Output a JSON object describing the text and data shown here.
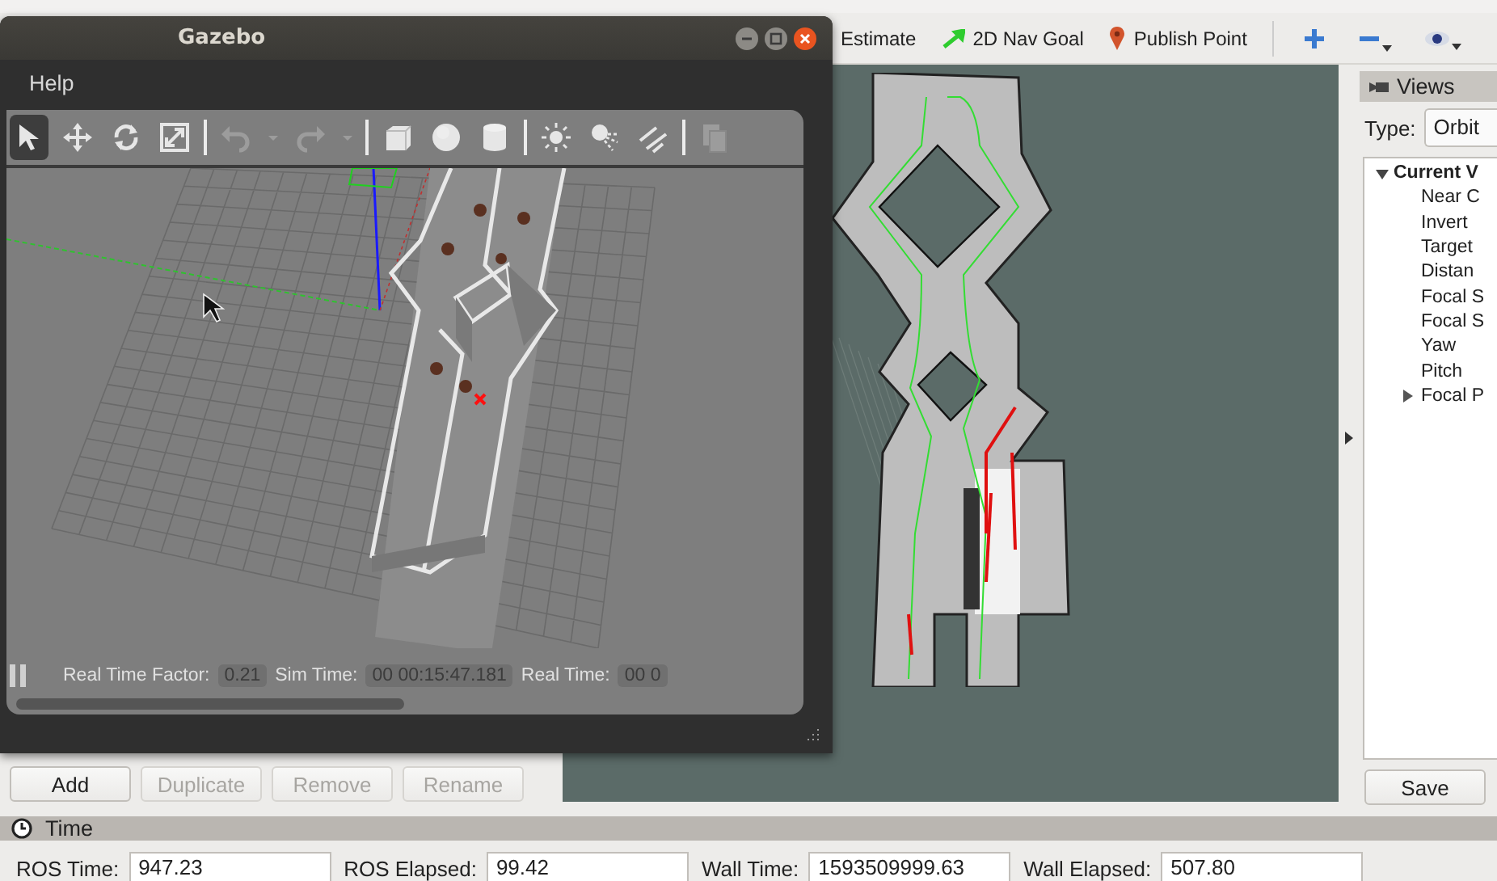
{
  "rviz": {
    "toolbar": [
      {
        "label": "Estimate"
      },
      {
        "label": "2D Nav Goal",
        "kind": "nav-goal"
      },
      {
        "label": "Publish Point",
        "kind": "point"
      }
    ],
    "view_tools": [
      {
        "kind": "zoom-in",
        "menu": false
      },
      {
        "kind": "zoom-out",
        "menu": true
      },
      {
        "kind": "eye",
        "menu": true
      }
    ],
    "displays_buttons": [
      {
        "label": "Add",
        "disabled": false
      },
      {
        "label": "Duplicate",
        "disabled": true
      },
      {
        "label": "Remove",
        "disabled": true
      },
      {
        "label": "Rename",
        "disabled": true
      }
    ],
    "views_panel": {
      "title": "Views",
      "type_label": "Type:",
      "type_value": "Orbit",
      "tree": [
        {
          "label": "Current V",
          "expanded": true,
          "children": [
            {
              "label": "Near C"
            },
            {
              "label": "Invert"
            },
            {
              "label": "Target"
            },
            {
              "label": "Distan"
            },
            {
              "label": "Focal S"
            },
            {
              "label": "Focal S"
            },
            {
              "label": "Yaw"
            },
            {
              "label": "Pitch"
            },
            {
              "label": "Focal P",
              "expanded": false
            }
          ]
        }
      ],
      "save_button": "Save"
    },
    "time_panel": {
      "title": "Time",
      "fields": [
        {
          "label": "ROS Time:",
          "value": "947.23"
        },
        {
          "label": "ROS Elapsed:",
          "value": "99.42"
        },
        {
          "label": "Wall Time:",
          "value": "1593509999.63"
        },
        {
          "label": "Wall Elapsed:",
          "value": "507.80"
        }
      ]
    }
  },
  "gazebo_window": {
    "title": "Gazebo",
    "menu": [
      "Help"
    ],
    "toolbar_groups": [
      [
        {
          "kind": "select",
          "selected": true,
          "disabled": false
        },
        {
          "kind": "translate",
          "selected": false,
          "disabled": false
        },
        {
          "kind": "rotate",
          "selected": false,
          "disabled": false
        },
        {
          "kind": "scale",
          "selected": false,
          "disabled": false
        }
      ],
      [
        {
          "kind": "undo",
          "selected": false,
          "disabled": true
        },
        {
          "kind": "undo-menu",
          "selected": false,
          "disabled": true
        },
        {
          "kind": "redo",
          "selected": false,
          "disabled": true
        },
        {
          "kind": "redo-menu",
          "selected": false,
          "disabled": true
        }
      ],
      [
        {
          "kind": "box",
          "selected": false,
          "disabled": false
        },
        {
          "kind": "sphere",
          "selected": false,
          "disabled": false
        },
        {
          "kind": "cylinder",
          "selected": false,
          "disabled": false
        }
      ],
      [
        {
          "kind": "point-light",
          "selected": false,
          "disabled": false
        },
        {
          "kind": "spot-light",
          "selected": false,
          "disabled": false
        },
        {
          "kind": "directional-light",
          "selected": false,
          "disabled": false
        }
      ],
      [
        {
          "kind": "copy",
          "selected": false,
          "disabled": true
        }
      ]
    ],
    "status": {
      "paused": false,
      "fields": [
        {
          "label": "Real Time Factor:",
          "value": "0.21"
        },
        {
          "label": "Sim Time:",
          "value": "00 00:15:47.181"
        },
        {
          "label": "Real Time:",
          "value": "00 0"
        }
      ]
    }
  }
}
